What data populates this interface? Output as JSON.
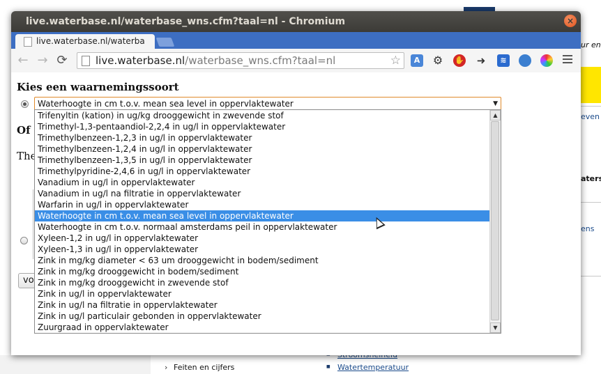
{
  "window": {
    "title": "live.waterbase.nl/waterbase_wns.cfm?taal=nl - Chromium",
    "close_label": "×"
  },
  "tab": {
    "label": "live.waterbase.nl/waterba",
    "close_label": "×"
  },
  "toolbar": {
    "back_label": "←",
    "forward_label": "→",
    "reload_label": "⟳",
    "url_host": "live.waterbase.nl",
    "url_path": "/waterbase_wns.cfm?taal=nl",
    "star_label": "☆"
  },
  "page": {
    "heading": "Kies een waarnemingssoort",
    "selected_value": "Waterhoogte in cm t.o.v. mean sea level in oppervlaktewater",
    "select_arrow": "▼",
    "partial_heading": "Of z",
    "partial_text": "The",
    "button_label": "vo"
  },
  "dropdown": {
    "options": [
      "Trifenyltin (kation) in ug/kg drooggewicht in zwevende stof",
      "Trimethyl-1,3-pentaandiol-2,2,4 in ug/l in oppervlaktewater",
      "Trimethylbenzeen-1,2,3 in ug/l in oppervlaktewater",
      "Trimethylbenzeen-1,2,4 in ug/l in oppervlaktewater",
      "Trimethylbenzeen-1,3,5 in ug/l in oppervlaktewater",
      "Trimethylpyridine-2,4,6 in ug/l in oppervlaktewater",
      "Vanadium in ug/l in oppervlaktewater",
      "Vanadium in ug/l na filtratie in oppervlaktewater",
      "Warfarin in ug/l in oppervlaktewater",
      "Waterhoogte in cm t.o.v. mean sea level in oppervlaktewater",
      "Waterhoogte in cm t.o.v. normaal amsterdams peil in oppervlaktewater",
      "Xyleen-1,2 in ug/l in oppervlaktewater",
      "Xyleen-1,3 in ug/l in oppervlaktewater",
      "Zink in mg/kg diameter < 63 um drooggewicht in bodem/sediment",
      "Zink in mg/kg drooggewicht in bodem/sediment",
      "Zink in mg/kg drooggewicht in zwevende stof",
      "Zink in ug/l in oppervlaktewater",
      "Zink in ug/l na filtratie in oppervlaktewater",
      "Zink in ug/l particulair gebonden in oppervlaktewater",
      "Zuurgraad in oppervlaktewater"
    ],
    "selected_index": 9,
    "scroll_up": "▲",
    "scroll_down": "▼"
  },
  "background": {
    "right_text_1": "ur en",
    "right_text_2": "even",
    "right_text_3": "aterst",
    "right_text_4": "ens",
    "bottom_link_1": "Feiten en cijfers",
    "bottom_link_2": "Watertemperatuur",
    "bottom_link_3": "Stroomsnelheid",
    "bottom_chevron": "›",
    "bullet": "■"
  }
}
